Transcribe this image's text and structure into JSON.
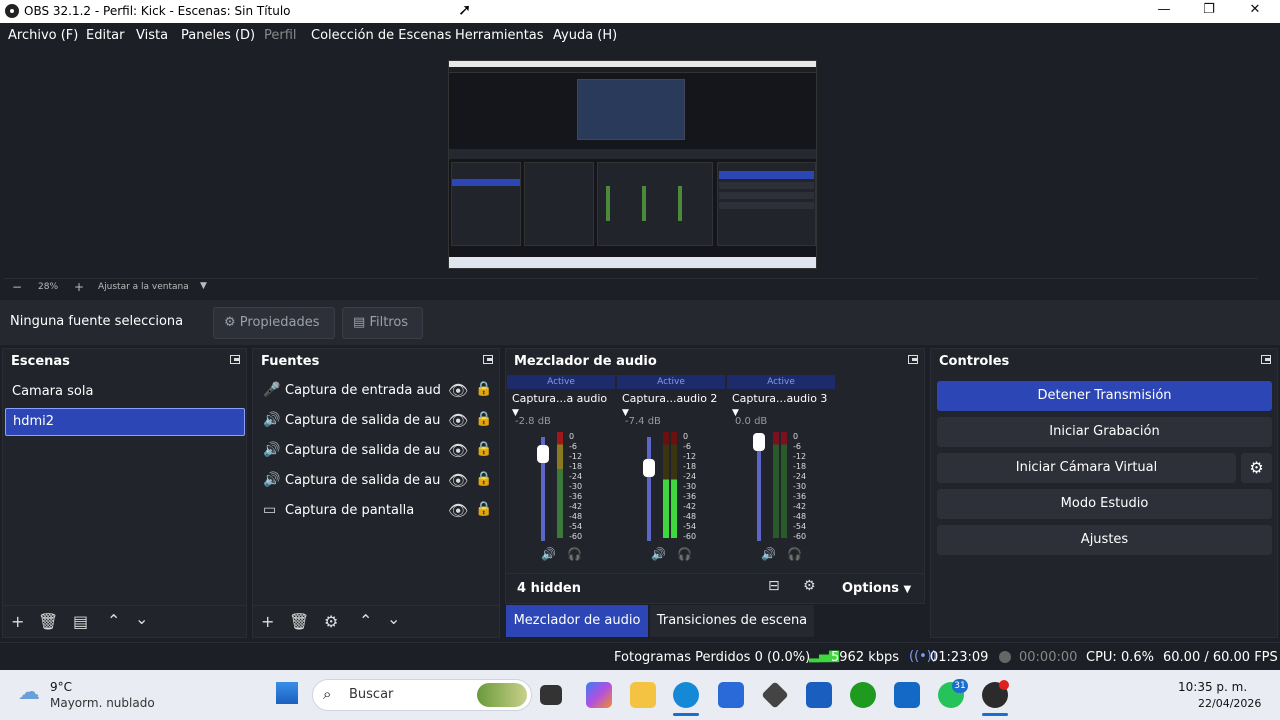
{
  "window": {
    "title": "OBS 32.1.2 - Perfil: Kick - Escenas: Sin Título"
  },
  "menu": [
    "Archivo (F)",
    "Editar",
    "Vista",
    "Paneles (D)",
    "Perfil",
    "Colección de Escenas",
    "Herramientas",
    "Ayuda (H)"
  ],
  "preview": {
    "zoom": "28%",
    "fit_label": "Ajustar a la ventana"
  },
  "source_bar": {
    "label": "Ninguna fuente selecciona",
    "properties": "Propiedades",
    "filters": "Filtros"
  },
  "scenes": {
    "title": "Escenas",
    "items": [
      "Camara sola",
      "hdmi2"
    ],
    "selected": 1
  },
  "sources": {
    "title": "Fuentes",
    "items": [
      "Captura de entrada audio",
      "Captura de salida de audio",
      "Captura de salida de audio",
      "Captura de salida de audio",
      "Captura de pantalla"
    ]
  },
  "mixer": {
    "title": "Mezclador de audio",
    "scale": [
      "0",
      "-6",
      "-12",
      "-18",
      "-24",
      "-30",
      "-36",
      "-42",
      "-48",
      "-54",
      "-60"
    ],
    "channels": [
      {
        "status": "Active",
        "name": "Captura...a audio",
        "db": "-2.8 dB"
      },
      {
        "status": "Active",
        "name": "Captura...audio 2",
        "db": "-7.4 dB"
      },
      {
        "status": "Active",
        "name": "Captura...audio 3",
        "db": "0.0 dB"
      }
    ],
    "hidden": "4 hidden",
    "options": "Options",
    "tab_mixer": "Mezclador de audio",
    "tab_transitions": "Transiciones de escena"
  },
  "controls": {
    "title": "Controles",
    "stop_stream": "Detener Transmisión",
    "start_record": "Iniciar Grabación",
    "virtual_cam": "Iniciar Cámara Virtual",
    "studio": "Modo Estudio",
    "settings": "Ajustes"
  },
  "status": {
    "dropped": "Fotogramas Perdidos 0 (0.0%)",
    "kbps": "5962 kbps",
    "stream_time": "01:23:09",
    "rec_time": "00:00:00",
    "cpu": "CPU: 0.6%",
    "fps": "60.00 / 60.00 FPS"
  },
  "taskbar": {
    "weather_temp": "9°C",
    "weather_desc": "Mayorm. nublado",
    "search": "Buscar",
    "whatsapp_badge": "31",
    "time": "10:35 p. m.",
    "date": "22/04/2026"
  },
  "colors": {
    "accent": "#2c46b5",
    "bg": "#1d1f26",
    "panel": "#22242b",
    "button": "#2e3039"
  }
}
